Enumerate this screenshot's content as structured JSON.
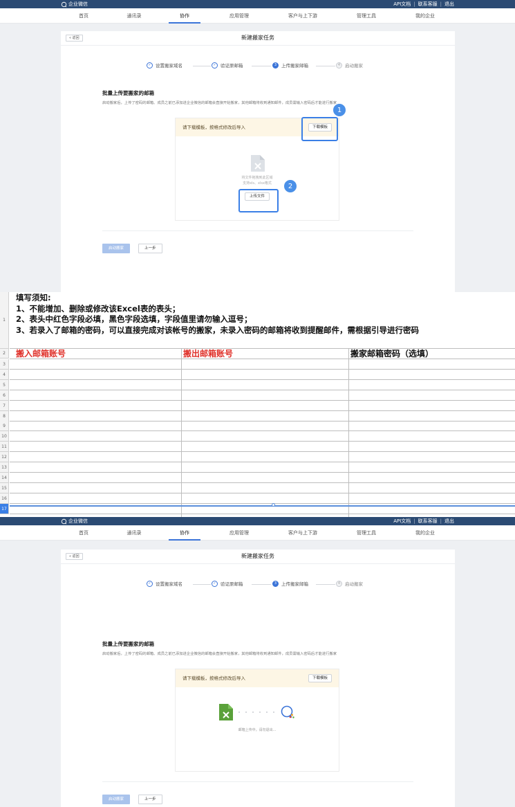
{
  "app": {
    "logo": "企业微信",
    "top_links": [
      "API文档",
      "联系客服",
      "退出"
    ],
    "nav": [
      "首页",
      "通讯录",
      "协作",
      "应用管理",
      "客户与上下游",
      "管理工具",
      "我的企业"
    ],
    "active_nav": "协作"
  },
  "migration": {
    "back": "« 返回",
    "title": "新建搬家任务",
    "steps": [
      {
        "label": "设置搬家域名",
        "marker": "✓",
        "state": "done"
      },
      {
        "label": "验证原邮箱",
        "marker": "✓",
        "state": "done"
      },
      {
        "label": "上传搬家邮箱",
        "marker": "3",
        "state": "current"
      },
      {
        "label": "启动搬家",
        "marker": "4",
        "state": "pending"
      }
    ],
    "upload_title": "批量上传要搬家的邮箱",
    "upload_desc": "启动搬家后，上传了密码的邮箱、成员之前已添加进企业微信的邮箱会直接开始搬家，其他邮箱将收到通知邮件，成员需输入密码后才能进行搬家",
    "tip": "请下载模板，按格式修改后导入",
    "download_button": "下载模板",
    "drop_hint_1": "将文件拖拽到此区域",
    "drop_hint_2": "支持xls、xlsx格式",
    "upload_button": "上传文件",
    "start_button": "启动搬家",
    "prev_button": "上一步",
    "uploading_text": "邮箱上传中，请勿退出..."
  },
  "callouts": [
    "1",
    "2"
  ],
  "spreadsheet": {
    "notes": [
      "填写须知:",
      "1、不能增加、删除或修改该Excel表的表头；",
      "2、表头中红色字段必填，黑色字段选填，字段值里请勿输入逗号；",
      "3、若录入了邮箱的密码，可以直接完成对该帐号的搬家，未录入密码的邮箱将收到提醒邮件，需根据引导进行密码"
    ],
    "columns": [
      {
        "label": "搬入邮箱账号",
        "required": true
      },
      {
        "label": "搬出邮箱账号",
        "required": true
      },
      {
        "label": "搬家邮箱密码（选填）",
        "required": false
      }
    ],
    "row_numbers": [
      "1",
      "2",
      "3",
      "4",
      "5",
      "6",
      "7",
      "8",
      "9",
      "10",
      "11",
      "12",
      "13",
      "14",
      "15",
      "16",
      "17"
    ],
    "selected_row": "17",
    "colors": {
      "required": "#e0322b",
      "optional": "#111111",
      "selection": "#3a7fe6"
    }
  }
}
